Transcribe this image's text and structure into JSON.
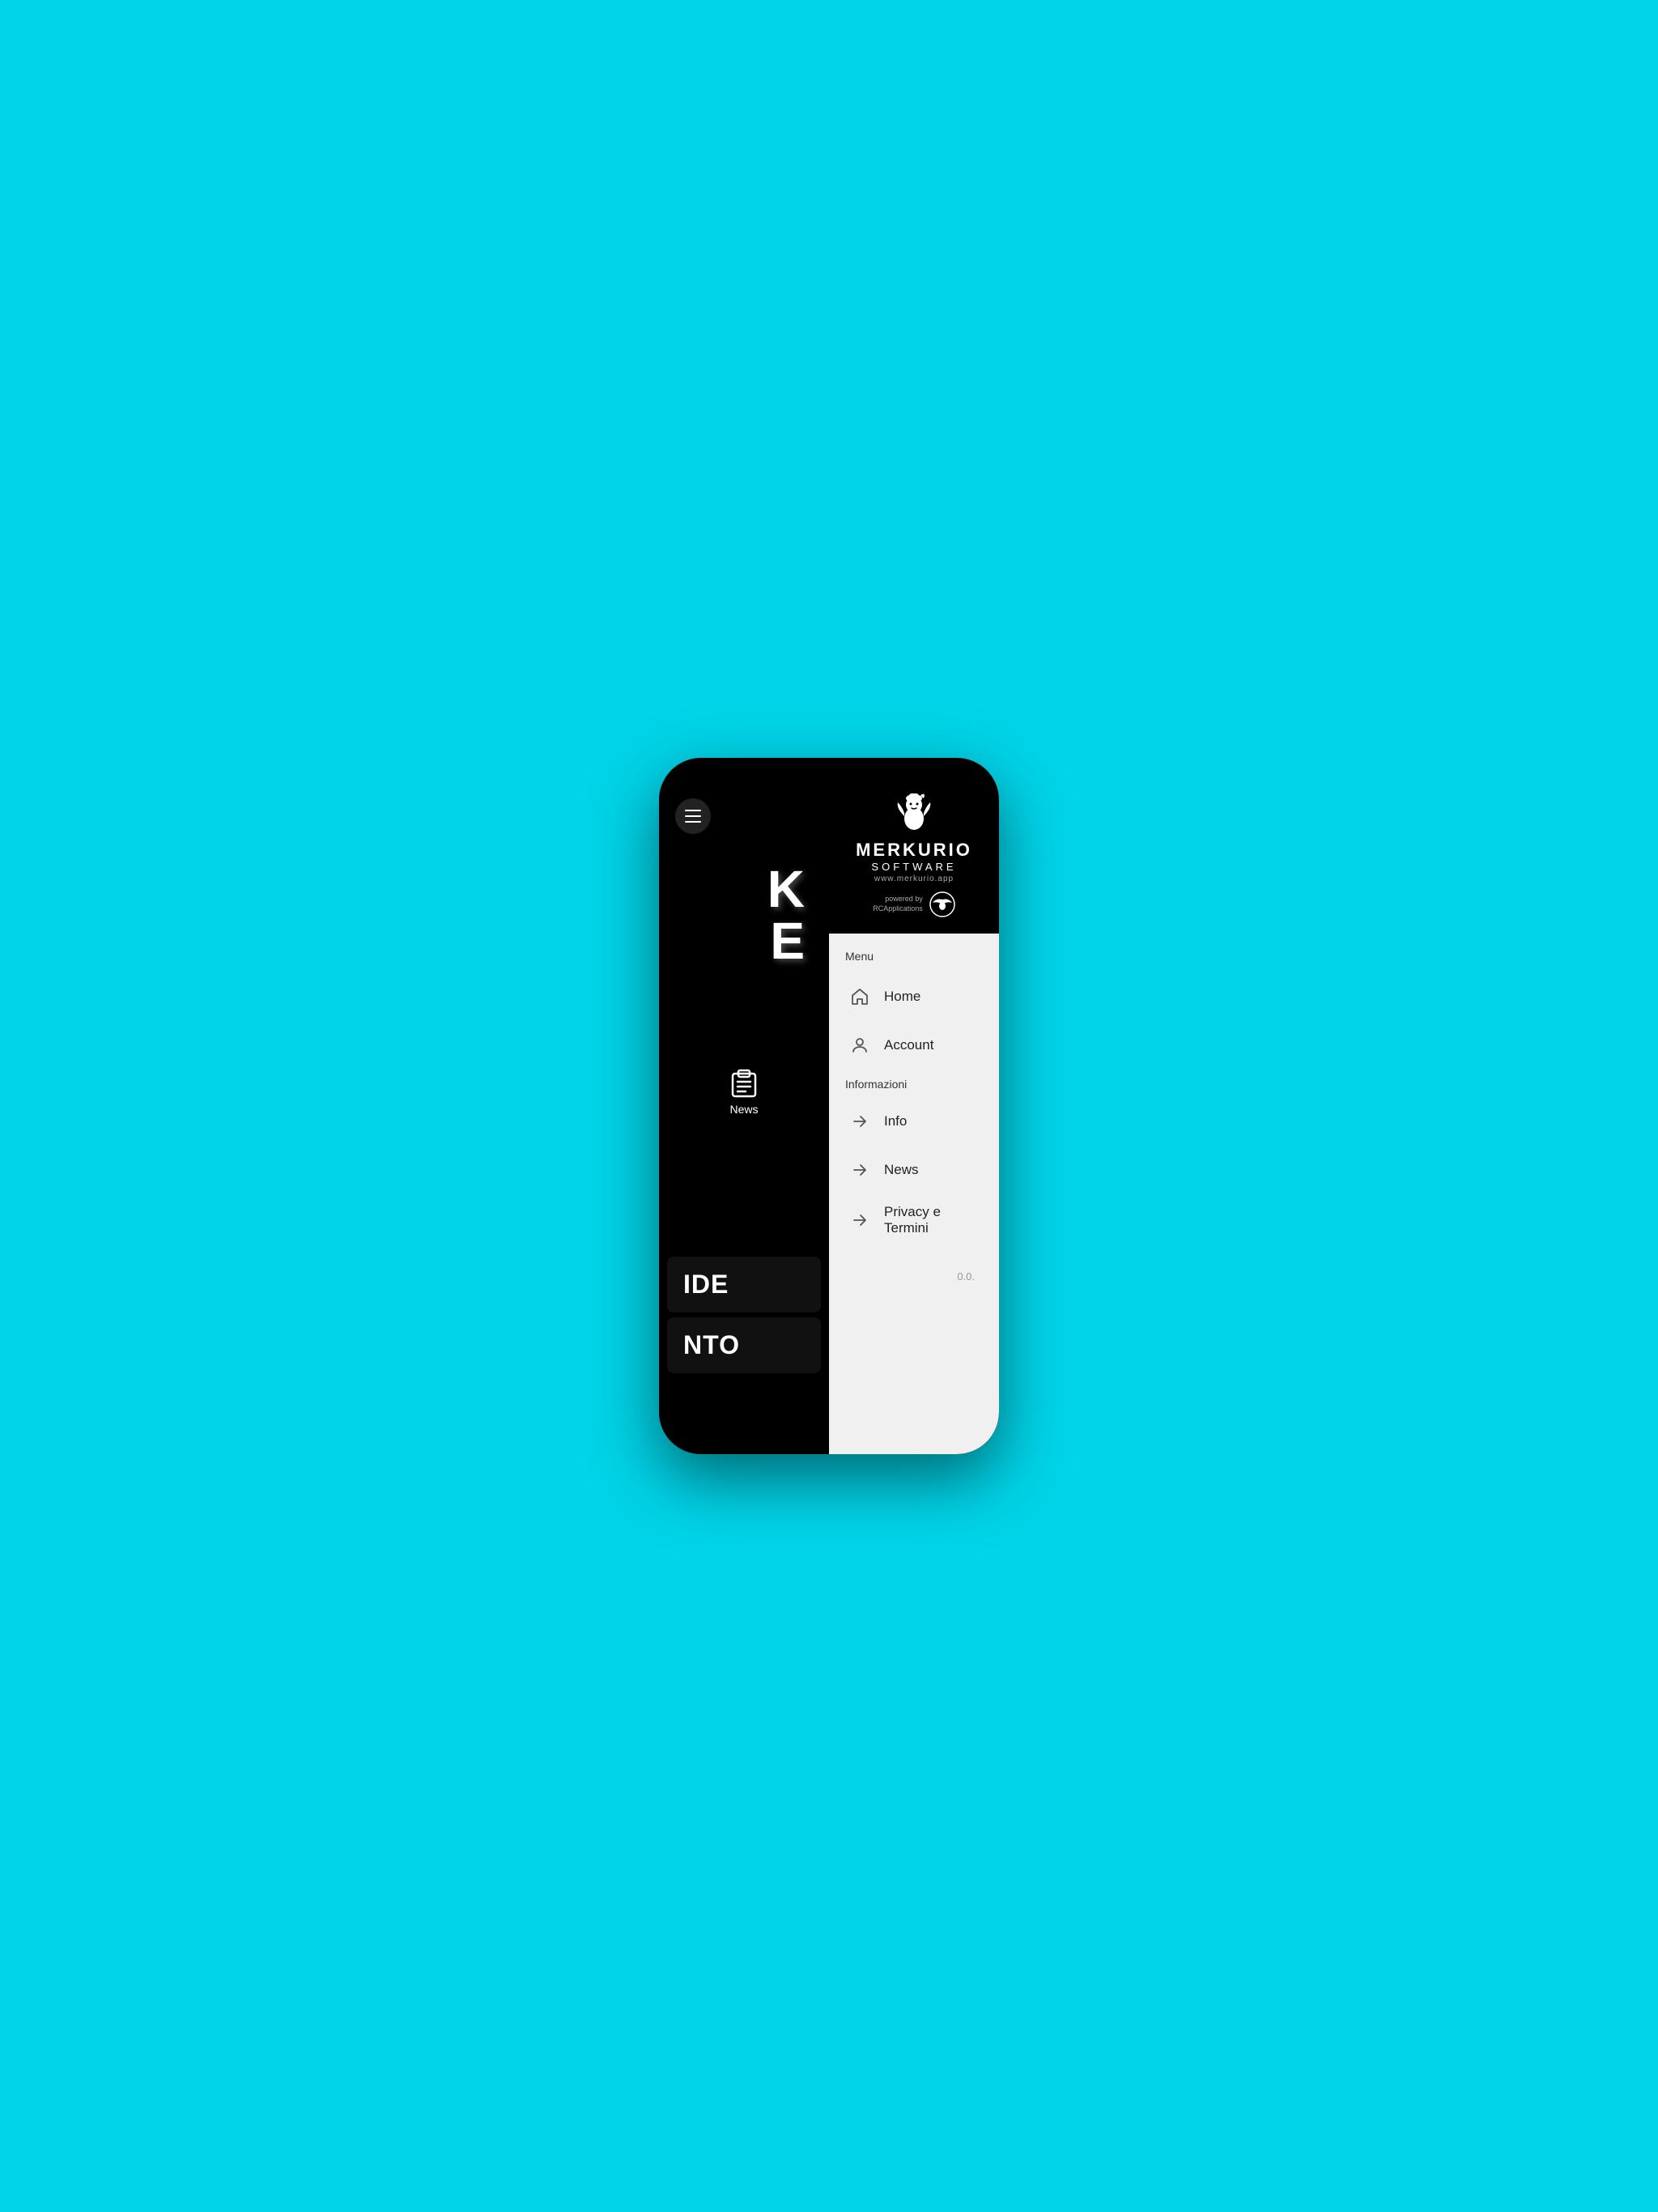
{
  "phone": {
    "background_color": "#00d4e8"
  },
  "header": {
    "logo": {
      "brand_name": "MERKURIO",
      "subtitle": "SOFTWARE",
      "url": "www.merkurio.app",
      "powered_by": "powered by\nRCApplications"
    }
  },
  "left_panel": {
    "app_letters": [
      "K",
      "E"
    ],
    "news_label": "News",
    "bottom_sections": [
      {
        "text": "IDE"
      },
      {
        "text": "NTO"
      }
    ]
  },
  "menu": {
    "section_menu_label": "Menu",
    "section_info_label": "Informazioni",
    "items_menu": [
      {
        "label": "Home",
        "icon": "home-icon"
      },
      {
        "label": "Account",
        "icon": "account-icon"
      }
    ],
    "items_info": [
      {
        "label": "Info",
        "icon": "arrow-icon"
      },
      {
        "label": "News",
        "icon": "arrow-icon"
      },
      {
        "label": "Privacy e Termini",
        "icon": "arrow-icon"
      }
    ],
    "version": "0.0."
  }
}
